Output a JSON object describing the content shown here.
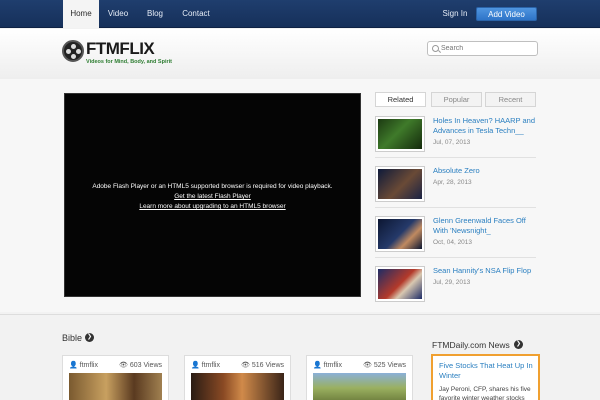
{
  "nav": {
    "items": [
      {
        "label": "Home",
        "active": true
      },
      {
        "label": "Video",
        "active": false
      },
      {
        "label": "Blog",
        "active": false
      },
      {
        "label": "Contact",
        "active": false
      }
    ],
    "sign_in": "Sign In",
    "add_video": "Add Video"
  },
  "header": {
    "logo_name": "FTMFLIX",
    "logo_tagline": "Videos for Mind, Body, and Spirit",
    "search_placeholder": "Search"
  },
  "player": {
    "message": "Adobe Flash Player or an HTML5 supported browser is required for video playback.",
    "link1": "Get the latest Flash Player",
    "link2": "Learn more about upgrading to an HTML5 browser"
  },
  "sidebar": {
    "tabs": [
      "Related",
      "Popular",
      "Recent"
    ],
    "active_tab": "Related",
    "items": [
      {
        "title": "Holes In Heaven? HAARP and Advances in Tesla Techn__",
        "date": "Jul, 07, 2013"
      },
      {
        "title": "Absolute Zero",
        "date": "Apr, 28, 2013"
      },
      {
        "title": "Glenn Greenwald Faces Off With 'Newsnight_",
        "date": "Oct, 04, 2013"
      },
      {
        "title": "Sean Hannity's NSA Flip Flop",
        "date": "Jul, 29, 2013"
      }
    ]
  },
  "bible": {
    "title": "Bible",
    "cards": [
      {
        "author": "ftmflix",
        "views": "603 Views"
      },
      {
        "author": "ftmflix",
        "views": "516 Views"
      },
      {
        "author": "ftmflix",
        "views": "525 Views"
      }
    ]
  },
  "news": {
    "title": "FTMDaily.com News",
    "headline": "Five Stocks That Heat Up In Winter",
    "excerpt": "Jay Peroni, CFP, shares his five favorite winter weather stocks"
  },
  "colors": {
    "nav_bg": "#1f3e6e",
    "accent_button": "#3a82d4",
    "link": "#2a7fc0",
    "news_border": "#f0a030"
  }
}
